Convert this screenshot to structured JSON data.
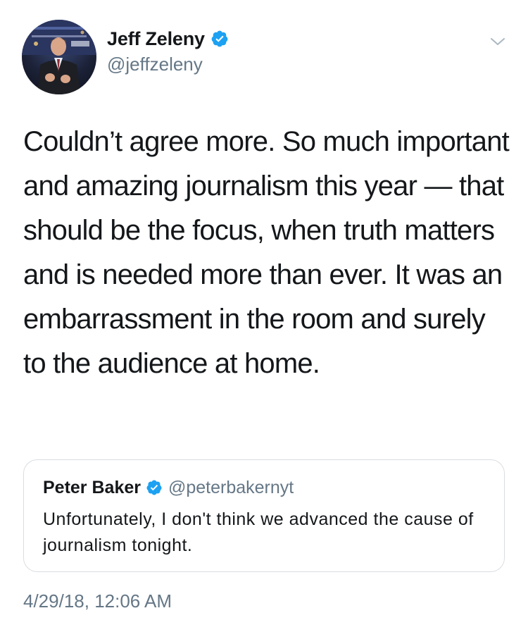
{
  "tweet": {
    "author": {
      "display_name": "Jeff Zeleny",
      "handle": "@jeffzeleny",
      "verified": true,
      "avatar_icon": "profile-photo"
    },
    "text": "Couldn’t agree more. So much important and amazing journalism this year — that should be the focus, when truth matters and is needed more than ever. It was an embarrassment in the room and surely to the audience at home.",
    "timestamp": "4/29/18, 12:06 AM",
    "menu_icon": "chevron-down-icon"
  },
  "quoted_tweet": {
    "display_name": "Peter Baker",
    "handle": "@peterbakernyt",
    "verified": true,
    "text": "Unfortunately, I don't think we advanced the cause of journalism tonight."
  },
  "colors": {
    "text_primary": "#14171a",
    "text_secondary": "#657786",
    "verified_blue": "#1da1f2",
    "card_border": "#d9dee2"
  }
}
